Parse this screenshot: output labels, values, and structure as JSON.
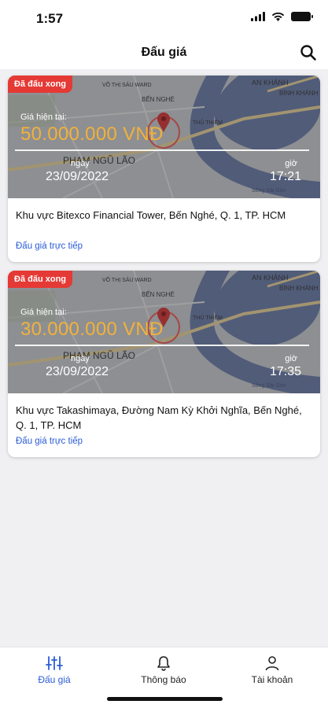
{
  "status_bar": {
    "time": "1:57"
  },
  "header": {
    "title": "Đấu giá"
  },
  "auctions": [
    {
      "badge": "Đã đấu xong",
      "price_label": "Giá hiện tại:",
      "price": "50.000.000 VNĐ",
      "date_label": "ngày",
      "date": "23/09/2022",
      "time_label": "giờ",
      "time": "17:21",
      "location": "Khu vực Bitexco Financial Tower, Bến Nghé, Q. 1, TP. HCM",
      "link": "Đấu giá trực tiếp",
      "map_labels": [
        "AN KHÁNH",
        "BÌNH KHÁNH",
        "VÕ THỊ SÁU WARD",
        "BẾN NGHÉ",
        "THỦ THIÊM",
        "PHẠM NGŨ LÃO",
        "Sông Sài Gòn"
      ]
    },
    {
      "badge": "Đã đấu xong",
      "price_label": "Giá hiện tại:",
      "price": "30.000.000 VNĐ",
      "date_label": "ngày",
      "date": "23/09/2022",
      "time_label": "giờ",
      "time": "17:35",
      "location": "Khu vực Takashimaya, Đường Nam Kỳ Khởi Nghĩa, Bến Nghé, Q. 1, TP. HCM",
      "link": "Đấu giá trực tiếp",
      "map_labels": [
        "AN KHÁNH",
        "BÌNH KHÁNH",
        "VÕ THỊ SÁU WARD",
        "BẾN NGHÉ",
        "THỦ THIÊM",
        "PHẠM NGŨ LÃO",
        "Sông Sài Gòn"
      ]
    }
  ],
  "bottom_nav": [
    {
      "label": "Đấu giá",
      "icon": "sliders-icon",
      "active": true
    },
    {
      "label": "Thông báo",
      "icon": "bell-icon",
      "active": false
    },
    {
      "label": "Tài khoản",
      "icon": "user-icon",
      "active": false
    }
  ],
  "colors": {
    "accent": "#2a5bd7",
    "badge": "#e53935",
    "price": "#f2b13a"
  }
}
